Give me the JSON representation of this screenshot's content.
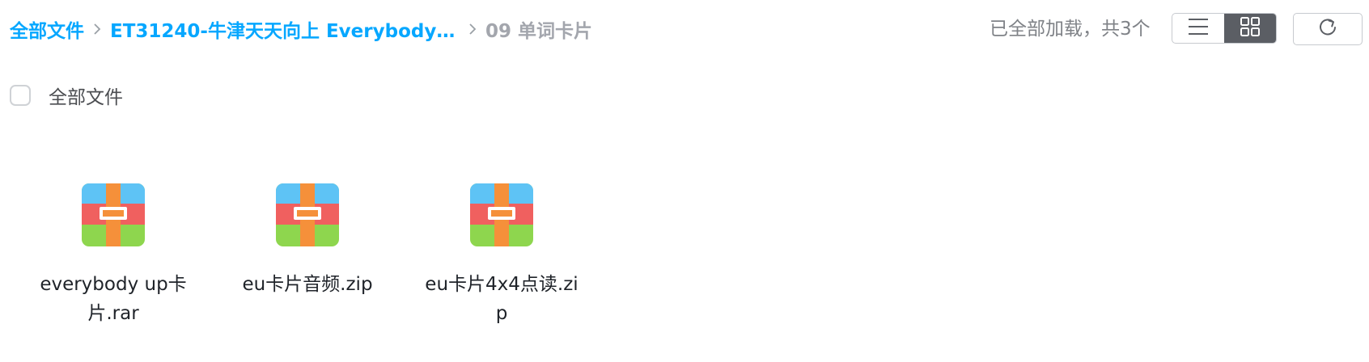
{
  "breadcrumb": {
    "root": "全部文件",
    "parent": "ET31240-牛津天天向上 Everybody Up...",
    "current": "09 单词卡片"
  },
  "status": {
    "loaded_text": "已全部加载，共3个"
  },
  "toolbar": {
    "list_view_icon": "list-view-icon",
    "grid_view_icon": "grid-view-icon",
    "refresh_icon": "refresh-icon",
    "active_view": "grid"
  },
  "select_all": {
    "label": "全部文件",
    "checked": false
  },
  "files": [
    {
      "name": "everybody up卡片.rar",
      "icon": "archive-icon"
    },
    {
      "name": "eu卡片音频.zip",
      "icon": "archive-icon"
    },
    {
      "name": "eu卡片4x4点读.zip",
      "icon": "archive-icon"
    }
  ],
  "colors": {
    "link": "#06a7ff",
    "muted": "#a3a6ad",
    "active_toggle": "#5b5e64",
    "archive_blue": "#5ec3f5",
    "archive_red": "#f0605f",
    "archive_green": "#8ed64e",
    "archive_orange": "#f5903a"
  }
}
